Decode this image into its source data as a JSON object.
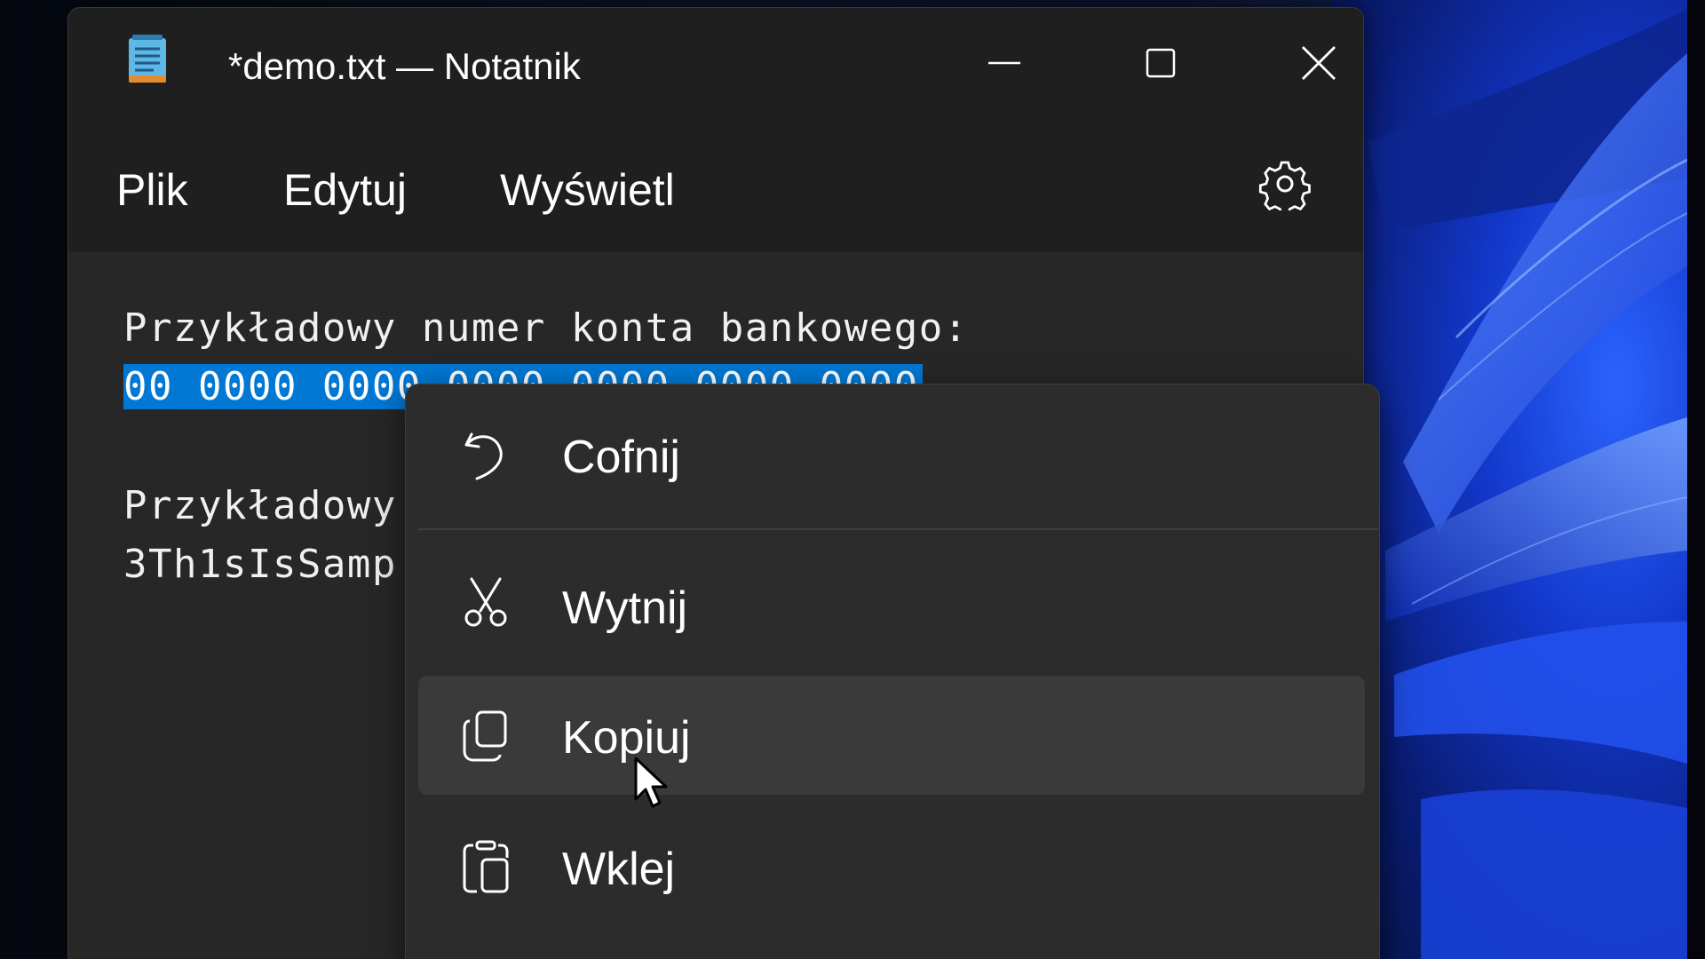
{
  "window": {
    "title": "*demo.txt — Notatnik"
  },
  "menubar": {
    "items": [
      {
        "label": "Plik"
      },
      {
        "label": "Edytuj"
      },
      {
        "label": "Wyświetl"
      }
    ],
    "settings_icon": "gear-icon"
  },
  "editor": {
    "lines": [
      "Przykładowy numer konta bankowego:",
      "00 0000 0000 0000 0000 0000 0000",
      "Przykładowy",
      "3Th1sIsSamp"
    ],
    "selection_color": "#0078d4"
  },
  "context_menu": {
    "items": [
      {
        "label": "Cofnij",
        "icon": "undo-icon"
      },
      {
        "label": "Wytnij",
        "icon": "scissors-icon"
      },
      {
        "label": "Kopiuj",
        "icon": "copy-icon",
        "hovered": true
      },
      {
        "label": "Wklej",
        "icon": "paste-icon"
      }
    ]
  },
  "colors": {
    "window_bg": "#202020",
    "editor_bg": "#272727",
    "menu_bg": "#2c2c2c",
    "hover_bg": "#3a3a3a",
    "accent": "#0078d4"
  }
}
